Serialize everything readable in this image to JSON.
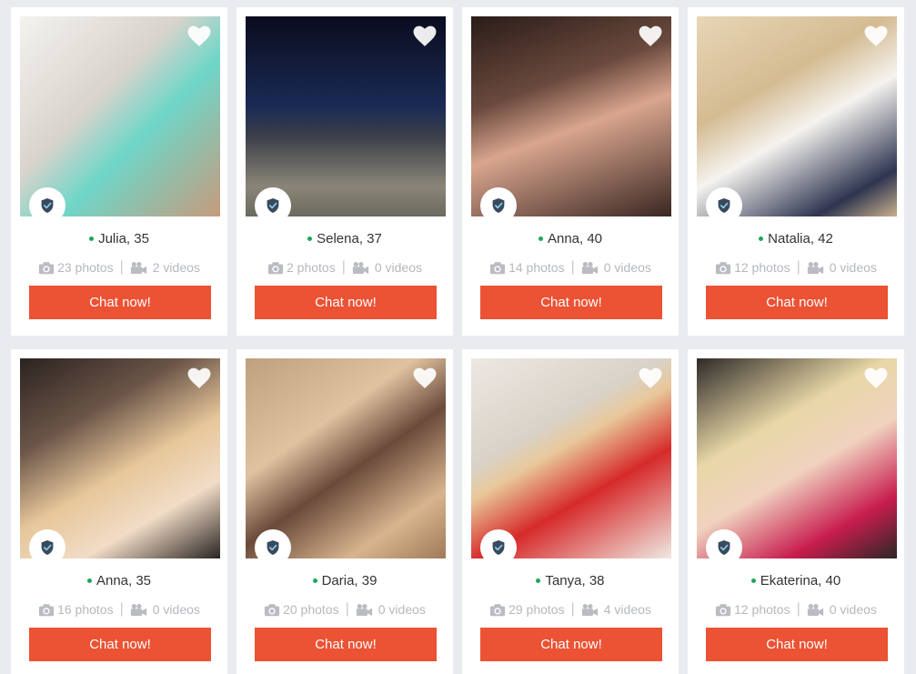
{
  "colors": {
    "accent": "#ec5234",
    "online": "#1ea65a",
    "muted_text": "#b5b8bd",
    "badge_icon": "#3a4a5e"
  },
  "icons": {
    "favorite": "heart-icon",
    "verified": "shield-check-icon",
    "photos": "camera-icon",
    "videos": "video-camera-icon"
  },
  "profiles": [
    {
      "name_age": "Julia, 35",
      "photos": "23 photos",
      "videos": "2 videos",
      "chat_label": "Chat now!",
      "online": true
    },
    {
      "name_age": "Selena, 37",
      "photos": "2 photos",
      "videos": "0 videos",
      "chat_label": "Chat now!",
      "online": true
    },
    {
      "name_age": "Anna, 40",
      "photos": "14 photos",
      "videos": "0 videos",
      "chat_label": "Chat now!",
      "online": true
    },
    {
      "name_age": "Natalia, 42",
      "photos": "12 photos",
      "videos": "0 videos",
      "chat_label": "Chat now!",
      "online": true
    },
    {
      "name_age": "Anna, 35",
      "photos": "16 photos",
      "videos": "0 videos",
      "chat_label": "Chat now!",
      "online": true
    },
    {
      "name_age": "Daria, 39",
      "photos": "20 photos",
      "videos": "0 videos",
      "chat_label": "Chat now!",
      "online": true
    },
    {
      "name_age": "Tanya, 38",
      "photos": "29 photos",
      "videos": "4 videos",
      "chat_label": "Chat now!",
      "online": true
    },
    {
      "name_age": "Ekaterina, 40",
      "photos": "12 photos",
      "videos": "0 videos",
      "chat_label": "Chat now!",
      "online": true
    }
  ]
}
